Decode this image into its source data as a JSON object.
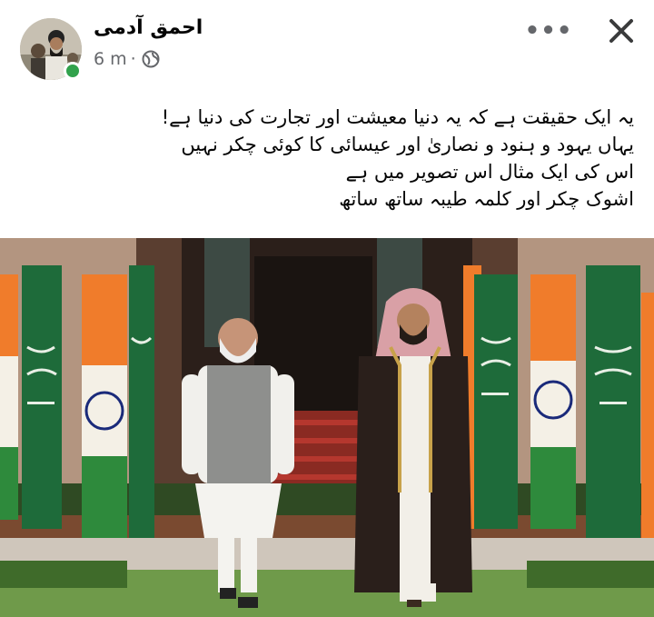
{
  "post": {
    "author": "احمق آدمی",
    "time": "6 m",
    "separator": "·",
    "privacy_icon": "globe-icon",
    "more_icon": "more-options-icon",
    "close_icon": "close-icon",
    "more_label": "•••",
    "text_lines": [
      "یہ ایک حقیقت ہے کہ یہ  دنیا معیشت اور تجارت کی دنیا ہے!",
      "یہاں  یہود و ہنود و نصاریٰ  اور عیسائی کا کوئی چکر نہیں",
      "اس کی ایک مثال اس تصویر میں ہے",
      "اشوک چکر اور کلمہ طیبہ  ساتھ ساتھ"
    ]
  },
  "colors": {
    "online": "#31a24c",
    "meta_text": "#65676b",
    "saudi_green": "#1e6b3a",
    "india_saffron": "#f07c2b",
    "india_green": "#2e8a3c",
    "carpet": "#c8332d"
  }
}
